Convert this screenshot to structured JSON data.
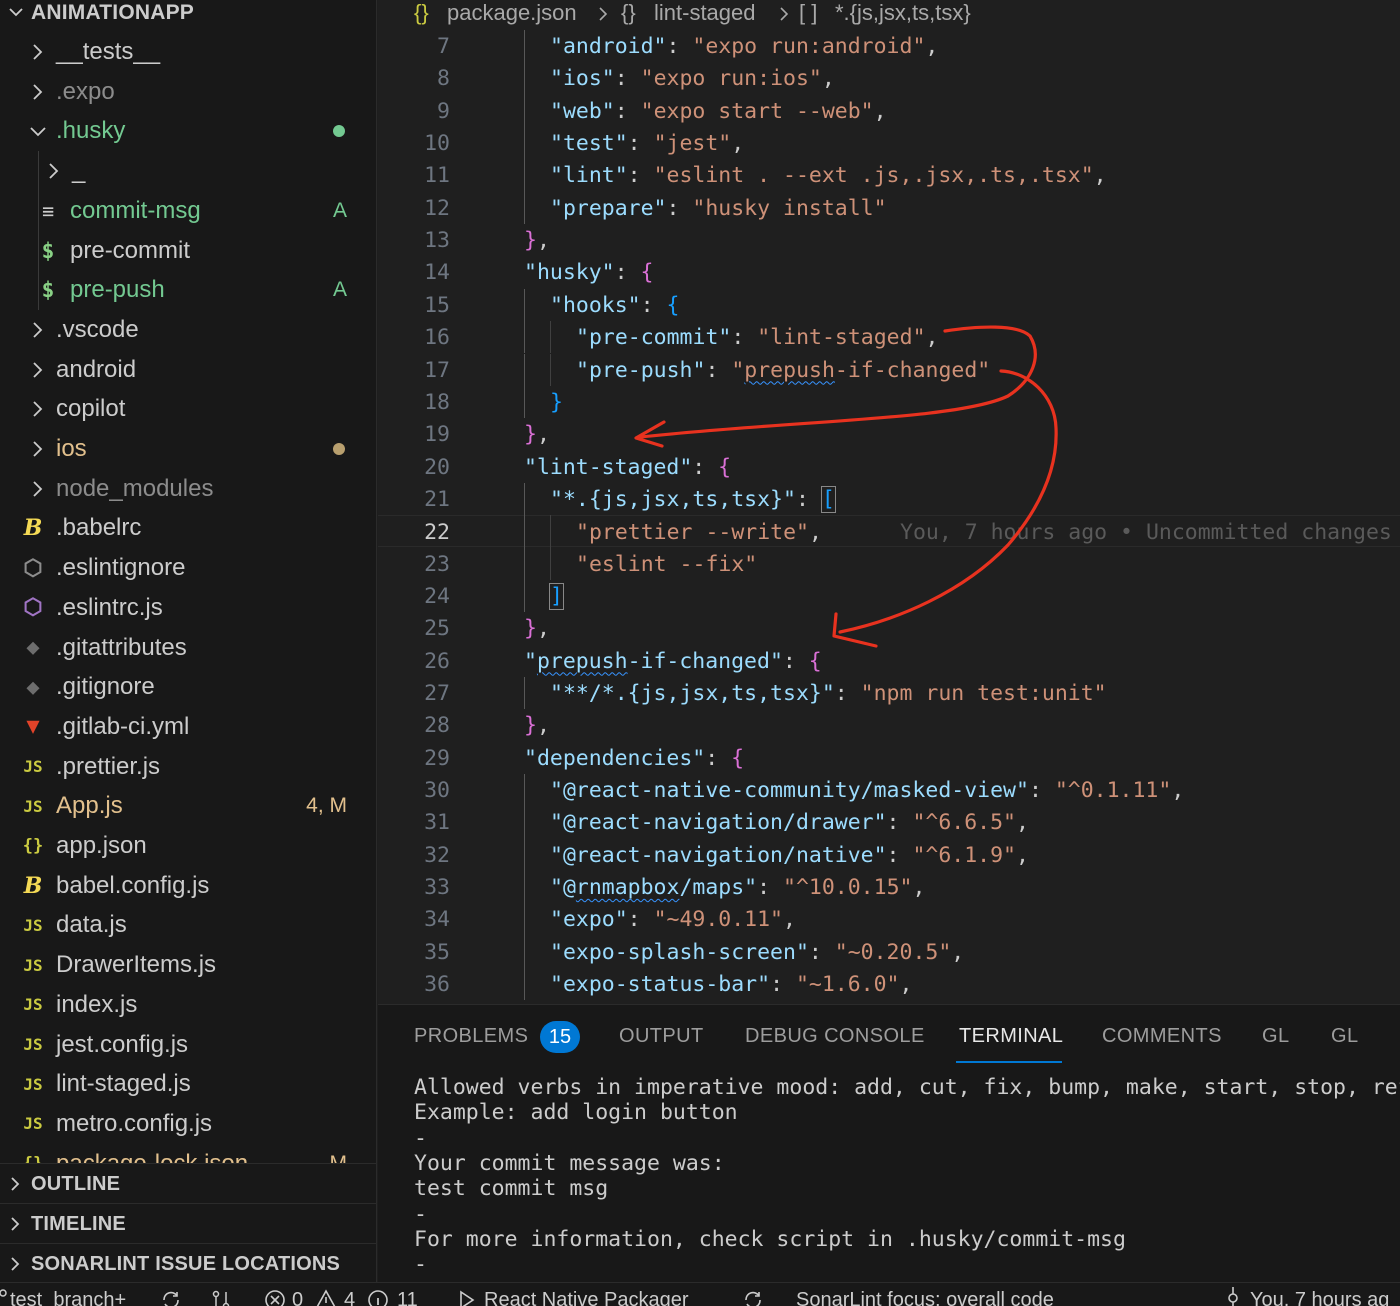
{
  "explorer": {
    "root_label": "ANIMATIONAPP",
    "items": [
      {
        "label": "__tests__",
        "kind": "folder",
        "expanded": false,
        "depth": 1,
        "color": "#cccccc",
        "icon": "chevron-right-icon"
      },
      {
        "label": ".expo",
        "kind": "folder",
        "expanded": false,
        "depth": 1,
        "color": "#8c8c8c",
        "icon": "chevron-right-icon"
      },
      {
        "label": ".husky",
        "kind": "folder",
        "expanded": true,
        "depth": 1,
        "color": "#73c991",
        "dot_color": "#73c991",
        "icon": "chevron-down-icon"
      },
      {
        "label": "_",
        "kind": "folder",
        "expanded": false,
        "depth": 2,
        "color": "#cccccc",
        "icon": "chevron-right-icon"
      },
      {
        "label": "commit-msg",
        "kind": "file",
        "depth": 2,
        "icon_glyph": "≡",
        "icon_color": "#cccccc",
        "color": "#73c991",
        "badge": "A",
        "badge_color": "#73c991",
        "icon": "text-file-icon"
      },
      {
        "label": "pre-commit",
        "kind": "file",
        "depth": 2,
        "icon_glyph": "$",
        "icon_color": "#89d185",
        "color": "#cccccc",
        "icon": "shell-script-icon"
      },
      {
        "label": "pre-push",
        "kind": "file",
        "depth": 2,
        "icon_glyph": "$",
        "icon_color": "#89d185",
        "color": "#73c991",
        "badge": "A",
        "badge_color": "#73c991",
        "icon": "shell-script-icon"
      },
      {
        "label": ".vscode",
        "kind": "folder",
        "expanded": false,
        "depth": 1,
        "color": "#cccccc",
        "icon": "chevron-right-icon"
      },
      {
        "label": "android",
        "kind": "folder",
        "expanded": false,
        "depth": 1,
        "color": "#cccccc",
        "icon": "chevron-right-icon"
      },
      {
        "label": "copilot",
        "kind": "folder",
        "expanded": false,
        "depth": 1,
        "color": "#cccccc",
        "icon": "chevron-right-icon"
      },
      {
        "label": "ios",
        "kind": "folder",
        "expanded": false,
        "depth": 1,
        "color": "#e2c08d",
        "dot_color": "#b89f6e",
        "icon": "chevron-right-icon"
      },
      {
        "label": "node_modules",
        "kind": "folder",
        "expanded": false,
        "depth": 1,
        "color": "#8c8c8c",
        "icon": "chevron-right-icon"
      },
      {
        "label": ".babelrc",
        "kind": "file",
        "depth": 0,
        "icon_glyph": "B",
        "icon_color": "#f5da55",
        "color": "#cccccc",
        "icon": "babel-icon"
      },
      {
        "label": ".eslintignore",
        "kind": "file",
        "depth": 0,
        "icon_glyph": "⬡",
        "icon_color": "#8c8c8c",
        "color": "#cccccc",
        "icon": "eslint-ignore-icon"
      },
      {
        "label": ".eslintrc.js",
        "kind": "file",
        "depth": 0,
        "icon_glyph": "⬡",
        "icon_color": "#a074c4",
        "color": "#cccccc",
        "icon": "eslint-icon"
      },
      {
        "label": ".gitattributes",
        "kind": "file",
        "depth": 0,
        "icon_glyph": "◆",
        "icon_color": "#6d6d6d",
        "color": "#cccccc",
        "icon": "git-icon"
      },
      {
        "label": ".gitignore",
        "kind": "file",
        "depth": 0,
        "icon_glyph": "◆",
        "icon_color": "#6d6d6d",
        "color": "#cccccc",
        "icon": "git-icon"
      },
      {
        "label": ".gitlab-ci.yml",
        "kind": "file",
        "depth": 0,
        "icon_glyph": "▼",
        "icon_color": "#e24329",
        "color": "#cccccc",
        "icon": "gitlab-icon"
      },
      {
        "label": ".prettier.js",
        "kind": "file",
        "depth": 0,
        "icon_glyph": "JS",
        "icon_color": "#cbcb41",
        "color": "#cccccc",
        "icon": "javascript-icon"
      },
      {
        "label": "App.js",
        "kind": "file",
        "depth": 0,
        "icon_glyph": "JS",
        "icon_color": "#cbcb41",
        "color": "#e2c08d",
        "badge": "4, M",
        "badge_color": "#e2c08d",
        "icon": "javascript-icon"
      },
      {
        "label": "app.json",
        "kind": "file",
        "depth": 0,
        "icon_glyph": "{}",
        "icon_color": "#cbcb41",
        "color": "#cccccc",
        "icon": "json-icon"
      },
      {
        "label": "babel.config.js",
        "kind": "file",
        "depth": 0,
        "icon_glyph": "B",
        "icon_color": "#f5da55",
        "color": "#cccccc",
        "icon": "babel-icon"
      },
      {
        "label": "data.js",
        "kind": "file",
        "depth": 0,
        "icon_glyph": "JS",
        "icon_color": "#cbcb41",
        "color": "#cccccc",
        "icon": "javascript-icon"
      },
      {
        "label": "DrawerItems.js",
        "kind": "file",
        "depth": 0,
        "icon_glyph": "JS",
        "icon_color": "#cbcb41",
        "color": "#cccccc",
        "icon": "javascript-icon"
      },
      {
        "label": "index.js",
        "kind": "file",
        "depth": 0,
        "icon_glyph": "JS",
        "icon_color": "#cbcb41",
        "color": "#cccccc",
        "icon": "javascript-icon"
      },
      {
        "label": "jest.config.js",
        "kind": "file",
        "depth": 0,
        "icon_glyph": "JS",
        "icon_color": "#cbcb41",
        "color": "#cccccc",
        "icon": "javascript-icon"
      },
      {
        "label": "lint-staged.js",
        "kind": "file",
        "depth": 0,
        "icon_glyph": "JS",
        "icon_color": "#cbcb41",
        "color": "#cccccc",
        "icon": "javascript-icon"
      },
      {
        "label": "metro.config.js",
        "kind": "file",
        "depth": 0,
        "icon_glyph": "JS",
        "icon_color": "#cbcb41",
        "color": "#cccccc",
        "icon": "javascript-icon"
      },
      {
        "label": "package-lock.json",
        "kind": "file",
        "depth": 0,
        "icon_glyph": "{}",
        "icon_color": "#cbcb41",
        "color": "#e2c08d",
        "badge": "M",
        "badge_color": "#e2c08d",
        "icon": "json-icon"
      }
    ],
    "sections": [
      "OUTLINE",
      "TIMELINE",
      "SONARLINT ISSUE LOCATIONS"
    ]
  },
  "breadcrumb": {
    "file_icon": "{}",
    "file": "package.json",
    "node1_icon": "{}",
    "node1": "lint-staged",
    "node2_icon": "[ ]",
    "node2": "*.{js,jsx,ts,tsx}"
  },
  "editor": {
    "current_line": 22,
    "blame_text": "You, 7 hours ago • Uncommitted changes",
    "lines": [
      {
        "n": 7,
        "indent": 2,
        "tokens": [
          [
            "k",
            "\"android\""
          ],
          [
            "p",
            ": "
          ],
          [
            "s",
            "\"expo run:android\""
          ],
          [
            "p",
            ","
          ]
        ]
      },
      {
        "n": 8,
        "indent": 2,
        "tokens": [
          [
            "k",
            "\"ios\""
          ],
          [
            "p",
            ": "
          ],
          [
            "s",
            "\"expo run:ios\""
          ],
          [
            "p",
            ","
          ]
        ]
      },
      {
        "n": 9,
        "indent": 2,
        "tokens": [
          [
            "k",
            "\"web\""
          ],
          [
            "p",
            ": "
          ],
          [
            "s",
            "\"expo start --web\""
          ],
          [
            "p",
            ","
          ]
        ]
      },
      {
        "n": 10,
        "indent": 2,
        "tokens": [
          [
            "k",
            "\"test\""
          ],
          [
            "p",
            ": "
          ],
          [
            "s",
            "\"jest\""
          ],
          [
            "p",
            ","
          ]
        ]
      },
      {
        "n": 11,
        "indent": 2,
        "tokens": [
          [
            "k",
            "\"lint\""
          ],
          [
            "p",
            ": "
          ],
          [
            "s",
            "\"eslint . --ext .js,.jsx,.ts,.tsx\""
          ],
          [
            "p",
            ","
          ]
        ]
      },
      {
        "n": 12,
        "indent": 2,
        "tokens": [
          [
            "k",
            "\"prepare\""
          ],
          [
            "p",
            ": "
          ],
          [
            "s",
            "\"husky install\""
          ]
        ]
      },
      {
        "n": 13,
        "indent": 1,
        "tokens": [
          [
            "b1",
            "}"
          ],
          [
            "p",
            ","
          ]
        ]
      },
      {
        "n": 14,
        "indent": 1,
        "tokens": [
          [
            "k",
            "\"husky\""
          ],
          [
            "p",
            ": "
          ],
          [
            "b1",
            "{"
          ]
        ]
      },
      {
        "n": 15,
        "indent": 2,
        "tokens": [
          [
            "k",
            "\"hooks\""
          ],
          [
            "p",
            ": "
          ],
          [
            "b2",
            "{"
          ]
        ]
      },
      {
        "n": 16,
        "indent": 3,
        "tokens": [
          [
            "k",
            "\"pre-commit\""
          ],
          [
            "p",
            ": "
          ],
          [
            "s",
            "\"lint-staged\""
          ],
          [
            "p",
            ","
          ]
        ]
      },
      {
        "n": 17,
        "indent": 3,
        "tokens": [
          [
            "k",
            "\"pre-push\""
          ],
          [
            "p",
            ": "
          ],
          [
            "s",
            "\""
          ],
          [
            "sq",
            "prepush"
          ],
          [
            "s",
            "-if-changed\""
          ]
        ]
      },
      {
        "n": 18,
        "indent": 2,
        "tokens": [
          [
            "b2",
            "}"
          ]
        ]
      },
      {
        "n": 19,
        "indent": 1,
        "tokens": [
          [
            "b1",
            "}"
          ],
          [
            "p",
            ","
          ]
        ]
      },
      {
        "n": 20,
        "indent": 1,
        "tokens": [
          [
            "k",
            "\"lint-staged\""
          ],
          [
            "p",
            ": "
          ],
          [
            "b1",
            "{"
          ]
        ]
      },
      {
        "n": 21,
        "indent": 2,
        "tokens": [
          [
            "k",
            "\"*.{js,jsx,ts,tsx}\""
          ],
          [
            "p",
            ": "
          ],
          [
            "bb",
            "["
          ]
        ]
      },
      {
        "n": 22,
        "indent": 3,
        "tokens": [
          [
            "s",
            "\"prettier --write\""
          ],
          [
            "p",
            ","
          ]
        ]
      },
      {
        "n": 23,
        "indent": 3,
        "tokens": [
          [
            "s",
            "\"eslint --fix\""
          ]
        ]
      },
      {
        "n": 24,
        "indent": 2,
        "tokens": [
          [
            "bb",
            "]"
          ]
        ]
      },
      {
        "n": 25,
        "indent": 1,
        "tokens": [
          [
            "b1",
            "}"
          ],
          [
            "p",
            ","
          ]
        ]
      },
      {
        "n": 26,
        "indent": 1,
        "tokens": [
          [
            "k",
            "\""
          ],
          [
            "ksq",
            "prepush"
          ],
          [
            "k",
            "-if-changed\""
          ],
          [
            "p",
            ": "
          ],
          [
            "b1",
            "{"
          ]
        ]
      },
      {
        "n": 27,
        "indent": 2,
        "tokens": [
          [
            "k",
            "\"**/*.{js,jsx,ts,tsx}\""
          ],
          [
            "p",
            ": "
          ],
          [
            "s",
            "\"npm run test:unit\""
          ]
        ]
      },
      {
        "n": 28,
        "indent": 1,
        "tokens": [
          [
            "b1",
            "}"
          ],
          [
            "p",
            ","
          ]
        ]
      },
      {
        "n": 29,
        "indent": 1,
        "tokens": [
          [
            "k",
            "\"dependencies\""
          ],
          [
            "p",
            ": "
          ],
          [
            "b1",
            "{"
          ]
        ]
      },
      {
        "n": 30,
        "indent": 2,
        "tokens": [
          [
            "k",
            "\"@react-native-community/masked-view\""
          ],
          [
            "p",
            ": "
          ],
          [
            "s",
            "\"^0.1.11\""
          ],
          [
            "p",
            ","
          ]
        ]
      },
      {
        "n": 31,
        "indent": 2,
        "tokens": [
          [
            "k",
            "\"@react-navigation/drawer\""
          ],
          [
            "p",
            ": "
          ],
          [
            "s",
            "\"^6.6.5\""
          ],
          [
            "p",
            ","
          ]
        ]
      },
      {
        "n": 32,
        "indent": 2,
        "tokens": [
          [
            "k",
            "\"@react-navigation/native\""
          ],
          [
            "p",
            ": "
          ],
          [
            "s",
            "\"^6.1.9\""
          ],
          [
            "p",
            ","
          ]
        ]
      },
      {
        "n": 33,
        "indent": 2,
        "tokens": [
          [
            "k",
            "\"@"
          ],
          [
            "ksq",
            "rnmapbox"
          ],
          [
            "k",
            "/maps\""
          ],
          [
            "p",
            ": "
          ],
          [
            "s",
            "\"^10.0.15\""
          ],
          [
            "p",
            ","
          ]
        ]
      },
      {
        "n": 34,
        "indent": 2,
        "tokens": [
          [
            "k",
            "\"expo\""
          ],
          [
            "p",
            ": "
          ],
          [
            "s",
            "\"~49.0.11\""
          ],
          [
            "p",
            ","
          ]
        ]
      },
      {
        "n": 35,
        "indent": 2,
        "tokens": [
          [
            "k",
            "\"expo-splash-screen\""
          ],
          [
            "p",
            ": "
          ],
          [
            "s",
            "\"~0.20.5\""
          ],
          [
            "p",
            ","
          ]
        ]
      },
      {
        "n": 36,
        "indent": 2,
        "tokens": [
          [
            "k",
            "\"expo-status-bar\""
          ],
          [
            "p",
            ": "
          ],
          [
            "s",
            "\"~1.6.0\""
          ],
          [
            "p",
            ","
          ]
        ]
      }
    ],
    "annotation_color": "#e8321f"
  },
  "panel": {
    "tabs": [
      {
        "label": "PROBLEMS",
        "active": false,
        "badge": "15"
      },
      {
        "label": "OUTPUT",
        "active": false
      },
      {
        "label": "DEBUG CONSOLE",
        "active": false
      },
      {
        "label": "TERMINAL",
        "active": true
      },
      {
        "label": "COMMENTS",
        "active": false
      },
      {
        "label": "GL",
        "active": false
      },
      {
        "label": "GL",
        "active": false
      }
    ],
    "terminal_lines": [
      "Allowed verbs in imperative mood: add, cut, fix, bump, make, start, stop, refac",
      "Example: add login button",
      "-",
      "Your commit message was:",
      "test commit msg",
      "-",
      "For more information, check script in .husky/commit-msg",
      "-"
    ]
  },
  "statusbar": {
    "branch": "test_branch+",
    "errors": "0",
    "warnings": "4",
    "infos": "11",
    "packager": "React Native Packager",
    "sonarlint": "SonarLint focus: overall code",
    "blame": "You, 7 hours ag"
  },
  "colors": {
    "accent": "#0078d4",
    "git_added": "#73c991",
    "git_modified": "#e2c08d"
  }
}
